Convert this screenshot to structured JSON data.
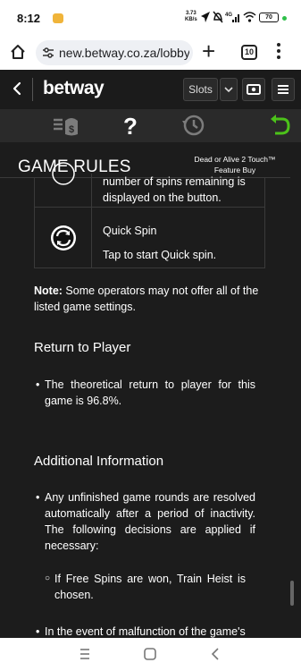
{
  "status_bar": {
    "time": "8:12",
    "speed_value": "3.73",
    "speed_unit": "KB/s",
    "network": "4G",
    "battery": "70"
  },
  "browser": {
    "url": "new.betway.co.za/lobby/",
    "tab_count": "10"
  },
  "site_header": {
    "logo": "betway",
    "category_select": "Slots"
  },
  "rules_panel": {
    "title": "GAME RULES",
    "game_name": "Dead or Alive 2 Touch™ Feature Buy",
    "autoplay_desc_tail": "number of spins remaining is displayed on the button.",
    "quick_spin_title": "Quick Spin",
    "quick_spin_desc": "Tap to start Quick spin.",
    "note_label": "Note:",
    "note_text": " Some operators may not offer all of the listed game settings.",
    "rtp_heading": "Return to Player",
    "rtp_bullet": "The theoretical return to player for this game is 96.8%.",
    "additional_heading": "Additional Information",
    "additional_bullet_1": "Any unfinished game rounds are resolved automatically after a period of inactivity. The following decisions are applied if necessary:",
    "sub_bullet_1": "If Free Spins are won, Train Heist is chosen.",
    "additional_bullet_2": "In the event of malfunction of the game's"
  },
  "colors": {
    "panel_bg": "#1c1c1c",
    "header_bg": "#1b1b1b",
    "toolbar_bg": "#2a2a2a",
    "toolbar_icon": "#7c7c7c",
    "undo_green": "#4cc21a"
  },
  "icons": {
    "toolbar": [
      "bet-settings-icon",
      "help-icon",
      "history-icon",
      "back-to-game-icon"
    ],
    "nav": [
      "recents-icon",
      "home-icon",
      "back-icon"
    ]
  }
}
